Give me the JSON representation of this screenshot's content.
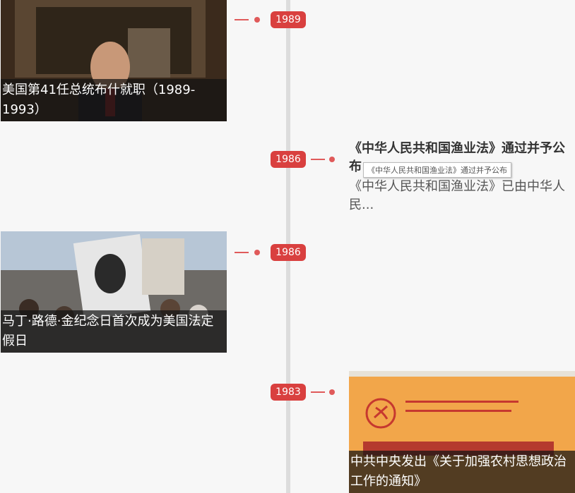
{
  "timeline": {
    "events": [
      {
        "year": "1989",
        "caption": "美国第41任总统布什就职（1989-1993）",
        "image_icon": "portrait-photo"
      },
      {
        "year": "1986",
        "title": "《中华人民共和国渔业法》通过并予公布",
        "tooltip": "《中华人民共和国渔业法》通过并予公布",
        "summary": "《中华人民共和国渔业法》已由中华人民..."
      },
      {
        "year": "1986",
        "caption": "马丁·路德·金纪念日首次成为美国法定假日",
        "image_icon": "march-photo"
      },
      {
        "year": "1983",
        "caption": "中共中央发出《关于加强农村思想政治工作的通知》",
        "image_icon": "document-cover-photo"
      }
    ]
  },
  "colors": {
    "accent": "#d9403f",
    "axis": "#dcdcdc"
  }
}
